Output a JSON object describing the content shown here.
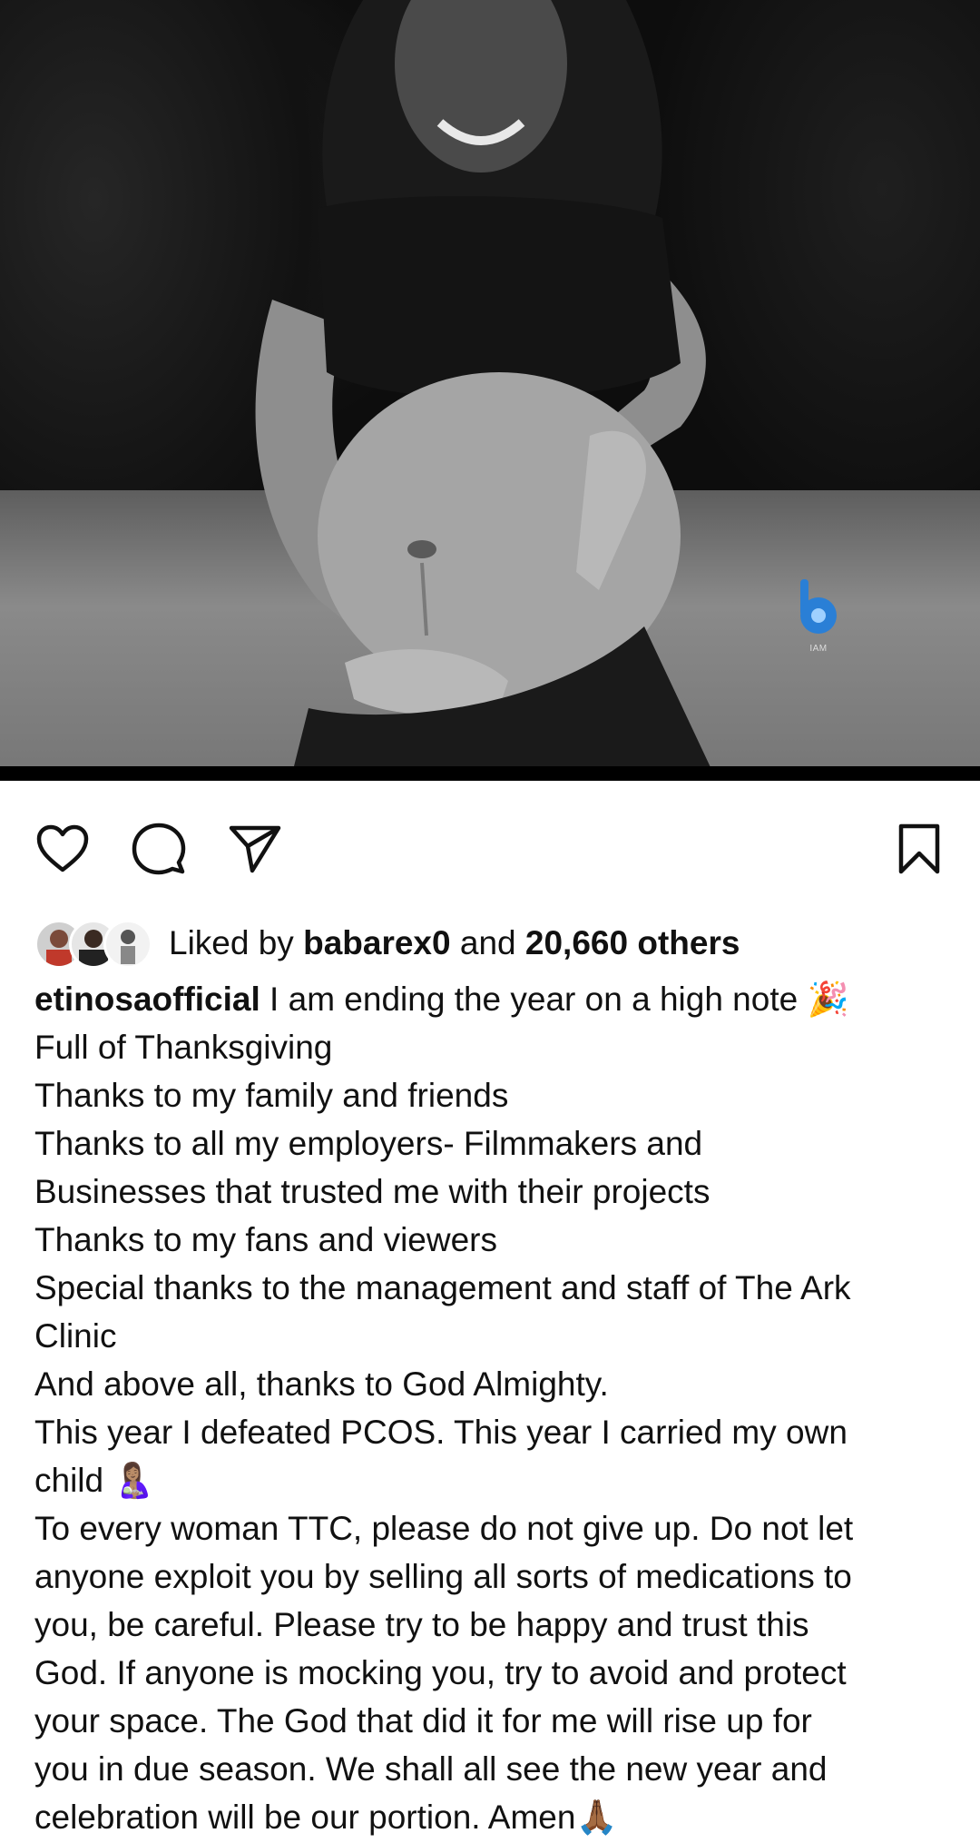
{
  "post": {
    "image_watermark": "IAM",
    "actions": {
      "like_icon": "heart-icon",
      "comment_icon": "comment-icon",
      "share_icon": "send-icon",
      "save_icon": "bookmark-icon"
    },
    "likes": {
      "prefix": "Liked by ",
      "first_user": "babarex0",
      "connector": " and ",
      "others": "20,660 others"
    },
    "caption": {
      "username": "etinosaofficial",
      "lines": [
        " I am ending the year on a high note 🎉",
        "Full of Thanksgiving",
        "Thanks to my family and friends",
        "Thanks to all my employers- Filmmakers and",
        "Businesses that trusted me with their projects",
        "Thanks to my fans and viewers",
        "Special thanks to the management and staff of The Ark",
        "Clinic",
        "And above all, thanks to God Almighty.",
        "This year I defeated PCOS. This year I carried my own",
        "child 🤱🏽",
        "To every woman TTC, please do not give up. Do not let",
        "anyone exploit you by selling all sorts of medications to",
        "you, be careful. Please try to be happy and trust this",
        "God. If anyone is mocking you, try to avoid and protect",
        "your space. The God that did it for me will rise up for",
        "you in due season. We shall all see the new year and",
        "celebration will be our portion. Amen🙏🏾"
      ]
    }
  }
}
